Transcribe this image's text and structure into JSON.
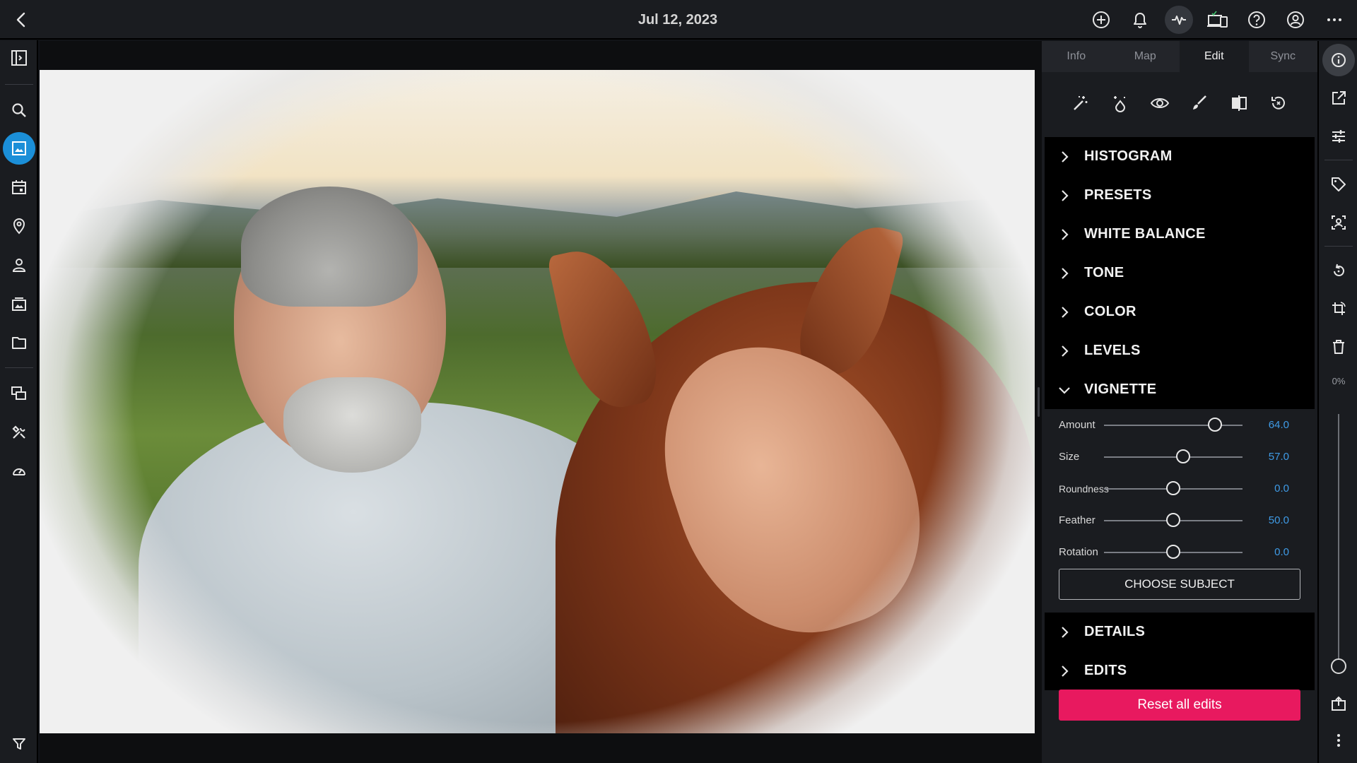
{
  "header": {
    "title": "Jul 12, 2023"
  },
  "tabs": [
    {
      "label": "Info"
    },
    {
      "label": "Map"
    },
    {
      "label": "Edit"
    },
    {
      "label": "Sync"
    }
  ],
  "active_tab": "Edit",
  "sections_top": [
    {
      "label": "HISTOGRAM"
    },
    {
      "label": "PRESETS"
    },
    {
      "label": "WHITE BALANCE"
    },
    {
      "label": "TONE"
    },
    {
      "label": "COLOR"
    },
    {
      "label": "LEVELS"
    }
  ],
  "vignette": {
    "label": "VIGNETTE",
    "sliders": [
      {
        "label": "Amount",
        "value": "64.0",
        "position": 0.8
      },
      {
        "label": "Size",
        "value": "57.0",
        "position": 0.57
      },
      {
        "label": "Roundness",
        "value": "0.0",
        "position": 0.5
      },
      {
        "label": "Feather",
        "value": "50.0",
        "position": 0.5
      },
      {
        "label": "Rotation",
        "value": "0.0",
        "position": 0.5
      }
    ],
    "choose_subject": "CHOOSE SUBJECT"
  },
  "sections_bottom": [
    {
      "label": "DETAILS"
    },
    {
      "label": "EDITS"
    }
  ],
  "reset_label": "Reset all edits",
  "zoom": {
    "label": "0%",
    "level": 0
  },
  "colors": {
    "accent": "#1b8fd8",
    "reset": "#e8195f",
    "value": "#3f9be6"
  }
}
